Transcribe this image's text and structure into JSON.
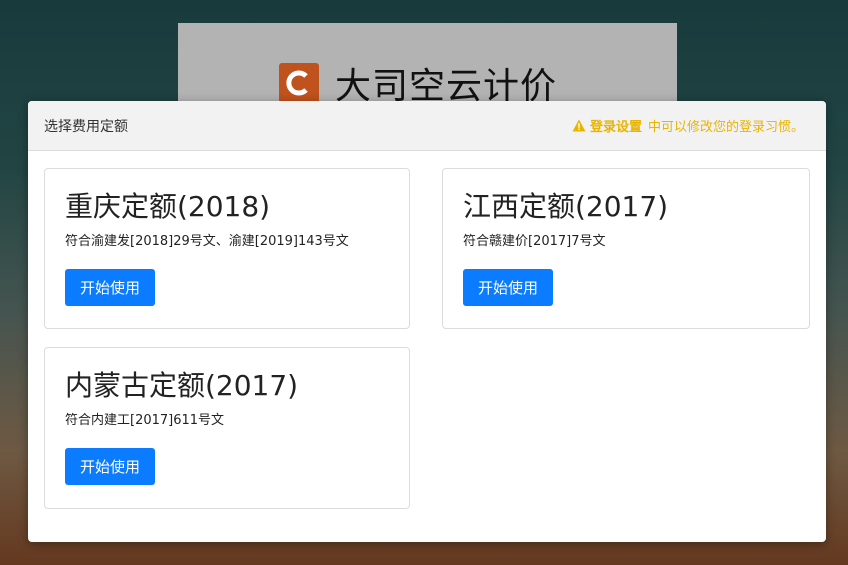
{
  "background": {
    "brand_name": "大司空云计价",
    "logo_letter": "C",
    "logo_color": "#c0521e"
  },
  "modal": {
    "title": "选择费用定额",
    "hint": {
      "icon": "warning-icon",
      "link_text": "登录设置",
      "text": "中可以修改您的登录习惯。",
      "color": "#e8b400"
    },
    "cards": [
      {
        "title": "重庆定额(2018)",
        "description": "符合渝建发[2018]29号文、渝建[2019]143号文",
        "button_label": "开始使用"
      },
      {
        "title": "江西定额(2017)",
        "description": "符合赣建价[2017]7号文",
        "button_label": "开始使用"
      },
      {
        "title": "内蒙古定额(2017)",
        "description": "符合内建工[2017]611号文",
        "button_label": "开始使用"
      }
    ],
    "button_color": "#0b7cff"
  }
}
